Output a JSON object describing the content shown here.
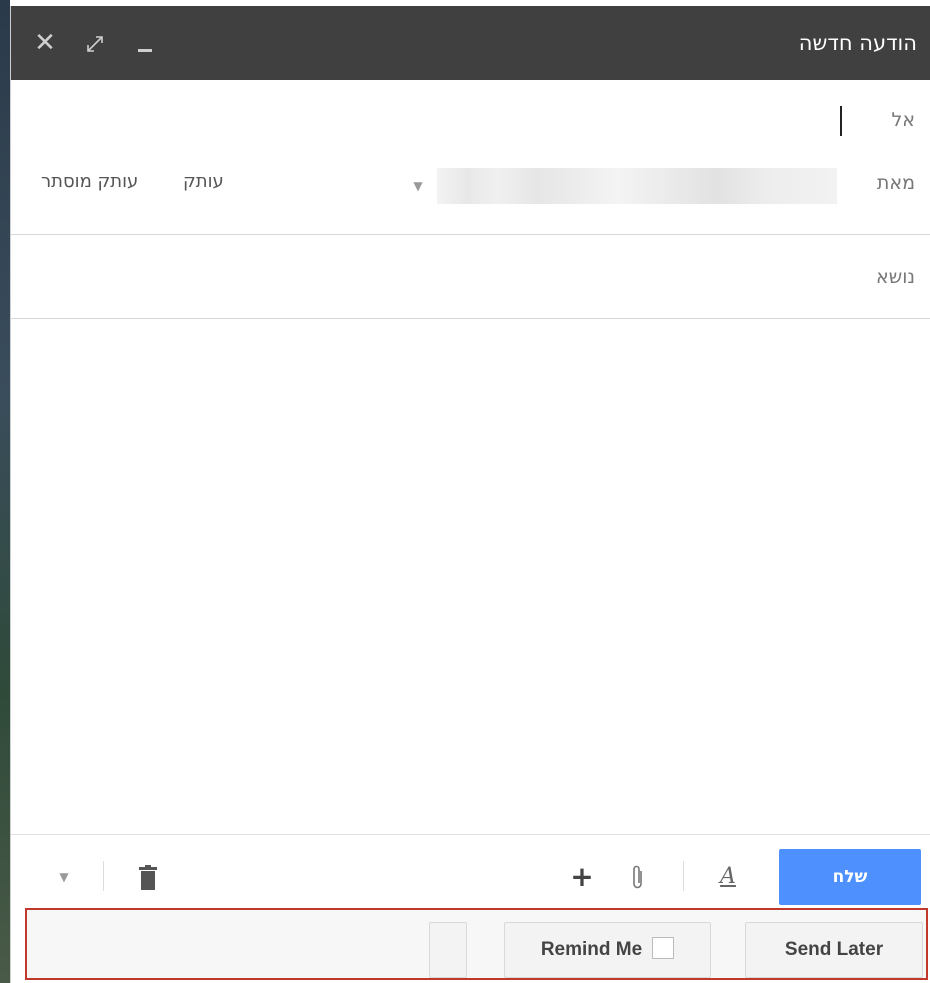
{
  "window": {
    "title": "הודעה חדשה",
    "controls": {
      "close_icon": "close-icon",
      "expand_icon": "expand-icon",
      "minimize_icon": "minimize-icon"
    }
  },
  "compose": {
    "to_label": "אל",
    "to_value": "",
    "from_label": "מאת",
    "cc_label": "עותק",
    "bcc_label": "עותק מוסתר",
    "subject_placeholder": "נושא",
    "subject_value": "",
    "body_value": ""
  },
  "toolbar": {
    "send_label": "שלח",
    "format_glyph": "A",
    "plus_glyph": "+"
  },
  "addon": {
    "send_later_label": "Send Later",
    "remind_me_label": "Remind Me",
    "remind_checked": false
  },
  "colors": {
    "titlebar": "#404040",
    "send_button": "#4d90fe",
    "addon_border": "#c0392b"
  }
}
